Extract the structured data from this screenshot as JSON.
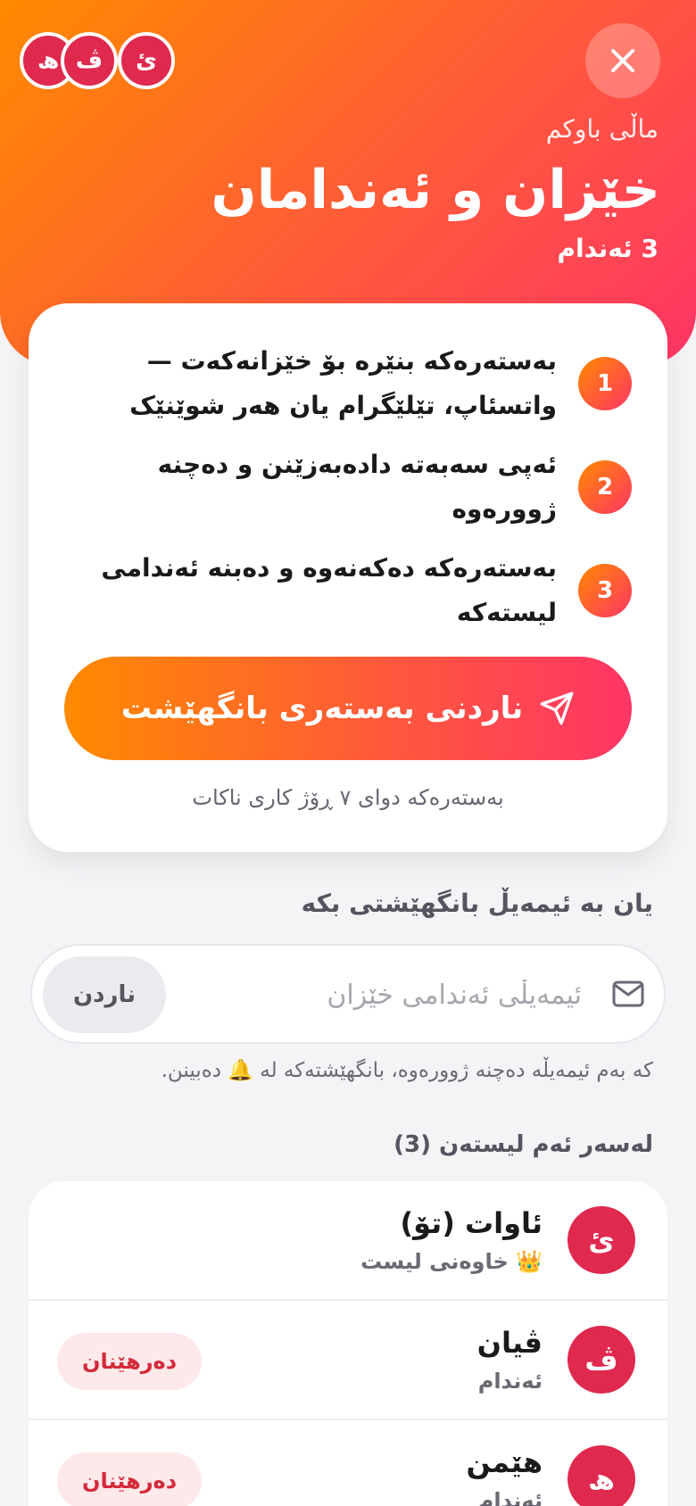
{
  "header": {
    "home_name": "ماڵی باوکم",
    "title": "خێزان و ئەندامان",
    "member_count": "3 ئەندام",
    "close_icon": "close-icon",
    "avatars": [
      "ئ",
      "ڤ",
      "ھ"
    ]
  },
  "invite_card": {
    "steps": [
      {
        "number": "1",
        "text": "بەستەرەکە بنێرە بۆ خێزانەکەت — واتسئاپ، تێلێگرام یان هەر شوێنێک"
      },
      {
        "number": "2",
        "text": "ئەپی سەبەتە دادەبەزێنن و دەچنە ژوورەوە"
      },
      {
        "number": "3",
        "text": "بەستەرەکە دەکەنەوە و دەبنە ئەندامی لیستەکە"
      }
    ],
    "send_button_label": "ناردنی بەستەری بانگهێشت",
    "send_icon": "send-icon",
    "expiry_note": "بەستەرەکە دوای ٧ ڕۆژ کاری ناکات"
  },
  "email_invite": {
    "heading": "یان بە ئیمەیڵ بانگهێشتی بکە",
    "placeholder": "ئیمەیڵی ئەندامی خێزان",
    "value": "",
    "send_label": "ناردن",
    "mail_icon": "mail-icon",
    "hint": "کە بەم ئیمەیڵە دەچنە ژوورەوە، بانگهێشتەکە لە 🔔 دەبینن."
  },
  "members": {
    "heading": "لەسەر ئەم لیستەن (3)",
    "items": [
      {
        "initial": "ئ",
        "name": "ئاوات (تۆ)",
        "role": "👑 خاوەنی لیست",
        "action": ""
      },
      {
        "initial": "ڤ",
        "name": "ڤیان",
        "role": "ئەندام",
        "action": "دەرهێنان"
      },
      {
        "initial": "ھ",
        "name": "هێمن",
        "role": "ئەندام",
        "action": "دەرهێنان"
      }
    ]
  },
  "colors": {
    "gradient_start": "#ff8a00",
    "gradient_end": "#ff3566",
    "avatar": "#e0294f",
    "remove_text": "#d42a3a",
    "remove_bg": "#fde8ea",
    "background": "#f4f4f7"
  }
}
